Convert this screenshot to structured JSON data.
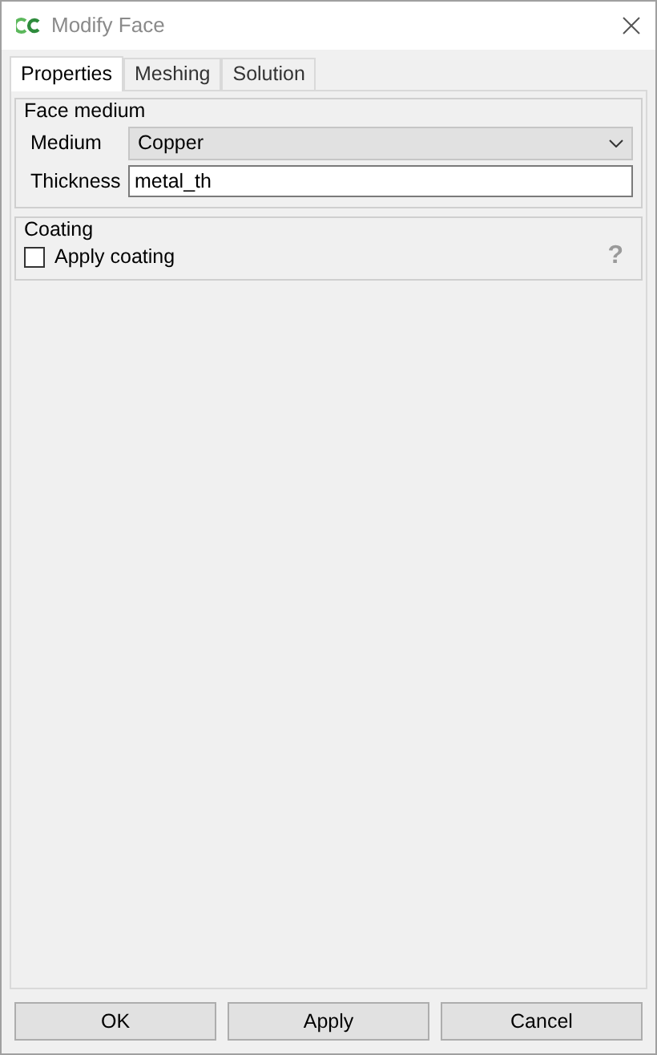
{
  "window": {
    "title": "Modify Face"
  },
  "tabs": [
    {
      "label": "Properties",
      "selected": true
    },
    {
      "label": "Meshing",
      "selected": false
    },
    {
      "label": "Solution",
      "selected": false
    }
  ],
  "face_medium": {
    "title": "Face medium",
    "medium_label": "Medium",
    "medium_value": "Copper",
    "thickness_label": "Thickness",
    "thickness_value": "metal_th"
  },
  "coating": {
    "title": "Coating",
    "apply_label": "Apply coating",
    "checked": false,
    "help": "?"
  },
  "buttons": [
    "OK",
    "Apply",
    "Cancel"
  ]
}
